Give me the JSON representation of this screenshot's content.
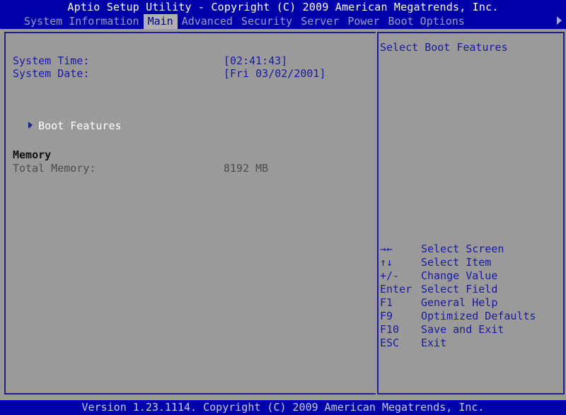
{
  "header": {
    "title": "Aptio Setup Utility - Copyright (C) 2009 American Megatrends, Inc.",
    "scroll_right_icon": "triangle-right-icon"
  },
  "menu": {
    "items": [
      {
        "label": "System Information",
        "selected": false
      },
      {
        "label": "Main",
        "selected": true
      },
      {
        "label": "Advanced",
        "selected": false
      },
      {
        "label": "Security",
        "selected": false
      },
      {
        "label": "Server",
        "selected": false
      },
      {
        "label": "Power",
        "selected": false
      },
      {
        "label": "Boot Options",
        "selected": false
      }
    ]
  },
  "main": {
    "settings": [
      {
        "label": "System Time:",
        "value": "[02:41:43]"
      },
      {
        "label": "System Date:",
        "value": "[Fri 03/02/2001]"
      }
    ],
    "submenu": {
      "label": "Boot Features",
      "icon": "triangle-right-icon"
    },
    "memory": {
      "heading": "Memory",
      "total_label": "Total Memory:",
      "total_value": "8192 MB"
    }
  },
  "help": {
    "text": "Select Boot Features"
  },
  "legend": [
    {
      "key": "→←",
      "desc": "Select Screen"
    },
    {
      "key": "↑↓",
      "desc": "Select Item"
    },
    {
      "key": "+/-",
      "desc": "Change Value"
    },
    {
      "key": "Enter",
      "desc": "Select Field"
    },
    {
      "key": "F1",
      "desc": "General Help"
    },
    {
      "key": "F9",
      "desc": "Optimized Defaults"
    },
    {
      "key": "F10",
      "desc": "Save and Exit"
    },
    {
      "key": "ESC",
      "desc": "Exit"
    }
  ],
  "footer": {
    "version": "Version 1.23.1114. Copyright (C) 2009 American Megatrends, Inc."
  },
  "colors": {
    "band_blue": "#0000aa",
    "panel_gray": "#9a9a9a",
    "border_blue": "#20208c",
    "text_blue": "#1a1aa0",
    "selected_tab_bg": "#b0b0b0",
    "menu_text": "#9a9aca"
  }
}
